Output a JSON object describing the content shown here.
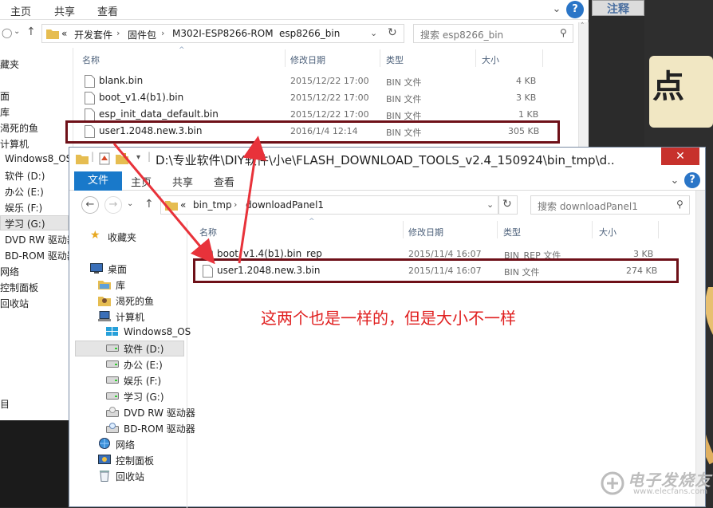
{
  "back_window": {
    "ribbon_tabs": [
      "主页",
      "共享",
      "查看"
    ],
    "breadcrumb": [
      "«",
      "开发套件",
      "固件包",
      "M302I-ESP8266-ROM",
      "esp8266_bin"
    ],
    "search_placeholder": "搜索 esp8266_bin",
    "columns": {
      "name": "名称",
      "date": "修改日期",
      "type": "类型",
      "size": "大小"
    },
    "files": [
      {
        "name": "blank.bin",
        "date": "2015/12/22 17:00",
        "type": "BIN 文件",
        "size": "4 KB"
      },
      {
        "name": "boot_v1.4(b1).bin",
        "date": "2015/12/22 17:00",
        "type": "BIN 文件",
        "size": "3 KB"
      },
      {
        "name": "esp_init_data_default.bin",
        "date": "2015/12/22 17:00",
        "type": "BIN 文件",
        "size": "1 KB"
      },
      {
        "name": "user1.2048.new.3.bin",
        "date": "2016/1/4 12:14",
        "type": "BIN 文件",
        "size": "305 KB"
      }
    ],
    "nav_items": [
      "藏夹",
      "面",
      "库",
      "渴死的鱼",
      "计算机",
      "Windows8_OS",
      "软件 (D:)",
      "办公 (E:)",
      "娱乐 (F:)",
      "学习 (G:)",
      "DVD RW 驱动器",
      "BD-ROM 驱动器",
      "网络",
      "控制面板",
      "回收站"
    ],
    "status_fragment": "目"
  },
  "front_window": {
    "title": "D:\\专业软件\\DIY软件\\小e\\FLASH_DOWNLOAD_TOOLS_v2.4_150924\\bin_tmp\\d...",
    "close_glyph": "✕",
    "ribbon_tabs": {
      "file": "文件",
      "home": "主页",
      "share": "共享",
      "view": "查看"
    },
    "breadcrumb": [
      "«",
      "bin_tmp",
      "downloadPanel1"
    ],
    "search_placeholder": "搜索 downloadPanel1",
    "columns": {
      "name": "名称",
      "date": "修改日期",
      "type": "类型",
      "size": "大小"
    },
    "files": [
      {
        "name": "boot_v1.4(b1).bin_rep",
        "date": "2015/11/4 16:07",
        "type": "BIN_REP 文件",
        "size": "3 KB"
      },
      {
        "name": "user1.2048.new.3.bin",
        "date": "2015/11/4 16:07",
        "type": "BIN 文件",
        "size": "274 KB"
      }
    ],
    "nav_items": [
      {
        "label": "收藏夹",
        "icon": "star-icon"
      },
      {
        "label": "桌面",
        "icon": "desktop-icon"
      },
      {
        "label": "库",
        "icon": "library-icon"
      },
      {
        "label": "渴死的鱼",
        "icon": "user-folder-icon"
      },
      {
        "label": "计算机",
        "icon": "computer-icon"
      },
      {
        "label": "Windows8_OS",
        "icon": "windows-drive-icon"
      },
      {
        "label": "软件 (D:)",
        "icon": "drive-icon"
      },
      {
        "label": "办公 (E:)",
        "icon": "drive-icon"
      },
      {
        "label": "娱乐 (F:)",
        "icon": "drive-icon"
      },
      {
        "label": "学习 (G:)",
        "icon": "drive-icon"
      },
      {
        "label": "DVD RW 驱动器",
        "icon": "dvd-drive-icon"
      },
      {
        "label": "BD-ROM 驱动器",
        "icon": "bd-drive-icon"
      },
      {
        "label": "网络",
        "icon": "network-icon"
      },
      {
        "label": "控制面板",
        "icon": "control-panel-icon"
      },
      {
        "label": "回收站",
        "icon": "recycle-bin-icon"
      }
    ],
    "selected_nav": "软件 (D:)"
  },
  "right_panel": {
    "button_label": "注释",
    "cartoon_text": "点"
  },
  "annotation": {
    "text": "这两个也是一样的，但是大小不一样",
    "color": "#e02020",
    "box_color": "#6e1018"
  },
  "watermark": {
    "line1": "电子发烧友",
    "line2": "www.elecfans.com"
  },
  "colors": {
    "file_tab_blue": "#1979ca",
    "close_red": "#c7312c",
    "arrow_red": "#e8323a"
  }
}
